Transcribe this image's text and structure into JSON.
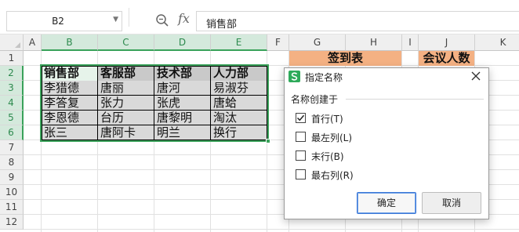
{
  "formula_bar": {
    "cell_ref": "B2",
    "content": "销售部",
    "fx_symbol": "fx"
  },
  "columns": [
    "A",
    "B",
    "C",
    "D",
    "E",
    "F",
    "G",
    "H",
    "I",
    "J",
    "K"
  ],
  "rows": [
    "1",
    "2",
    "3",
    "4",
    "5",
    "6",
    "7",
    "8",
    "9",
    "10",
    "11",
    "12"
  ],
  "table": {
    "headers": [
      "销售部",
      "客服部",
      "技术部",
      "人力部"
    ],
    "rows": [
      [
        "李猎德",
        "唐丽",
        "唐河",
        "易淑芬"
      ],
      [
        "李答复",
        "张力",
        "张虎",
        "唐蛤"
      ],
      [
        "李恩德",
        "台历",
        "唐黎明",
        "淘汰"
      ],
      [
        "张三",
        "唐阿卡",
        "明兰",
        "换行"
      ]
    ]
  },
  "extra_cells": {
    "sign_in": "签到表",
    "meeting_count": "会议人数"
  },
  "dialog": {
    "title": "指定名称",
    "section_label": "名称创建于",
    "options": [
      {
        "label": "首行(T)",
        "checked": true
      },
      {
        "label": "最左列(L)",
        "checked": false
      },
      {
        "label": "末行(B)",
        "checked": false
      },
      {
        "label": "最右列(R)",
        "checked": false
      }
    ],
    "ok_label": "确定",
    "cancel_label": "取消"
  },
  "colors": {
    "accent_green": "#3aa25a",
    "header_fill": "#c9c9c9",
    "data_fill": "#d9d9d9",
    "orange_fill": "#f4b183",
    "dialog_icon": "#2eaa5a"
  }
}
